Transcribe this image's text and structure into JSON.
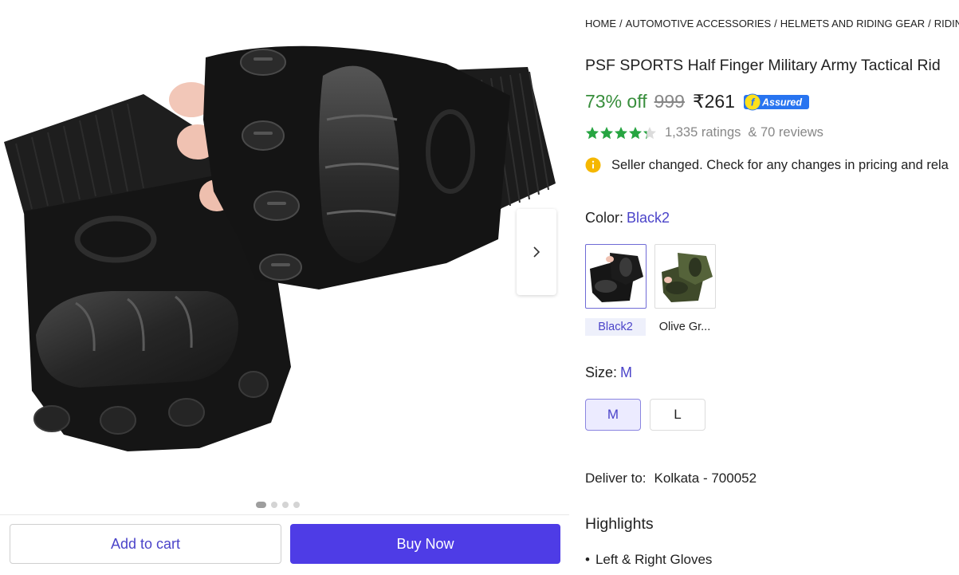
{
  "gallery": {
    "image_alt": "Black half finger tactical gloves",
    "dots": [
      true,
      false,
      false,
      false
    ]
  },
  "actions": {
    "add_to_cart": "Add to cart",
    "buy_now": "Buy Now"
  },
  "breadcrumbs": [
    "HOME",
    "AUTOMOTIVE ACCESSORIES",
    "HELMETS AND RIDING GEAR",
    "RIDING G"
  ],
  "product": {
    "title": "PSF SPORTS Half Finger Military Army Tactical Rid",
    "discount": "73% off",
    "mrp": "999",
    "price": "₹261",
    "assured_label": "Assured",
    "rating_value": 4.3,
    "ratings_text": "1,335 ratings",
    "reviews_text": "& 70 reviews"
  },
  "notice": {
    "icon": "info-icon",
    "text": "Seller changed. Check for any changes in pricing and rela"
  },
  "color": {
    "label": "Color:",
    "selected": "Black2",
    "options": [
      {
        "name": "Black2",
        "selected": true
      },
      {
        "name": "Olive Gr...",
        "selected": false
      }
    ]
  },
  "size": {
    "label": "Size:",
    "selected": "M",
    "options": [
      {
        "name": "M",
        "selected": true
      },
      {
        "name": "L",
        "selected": false
      }
    ]
  },
  "delivery": {
    "label": "Deliver to:",
    "location": "Kolkata - 700052"
  },
  "highlights": {
    "title": "Highlights",
    "items": [
      "Left & Right Gloves"
    ]
  },
  "colors": {
    "accent": "#4b44c9",
    "buy": "#4e3ce6",
    "discount": "#388e3c",
    "star": "#26a541",
    "assured": "#2874f0"
  }
}
